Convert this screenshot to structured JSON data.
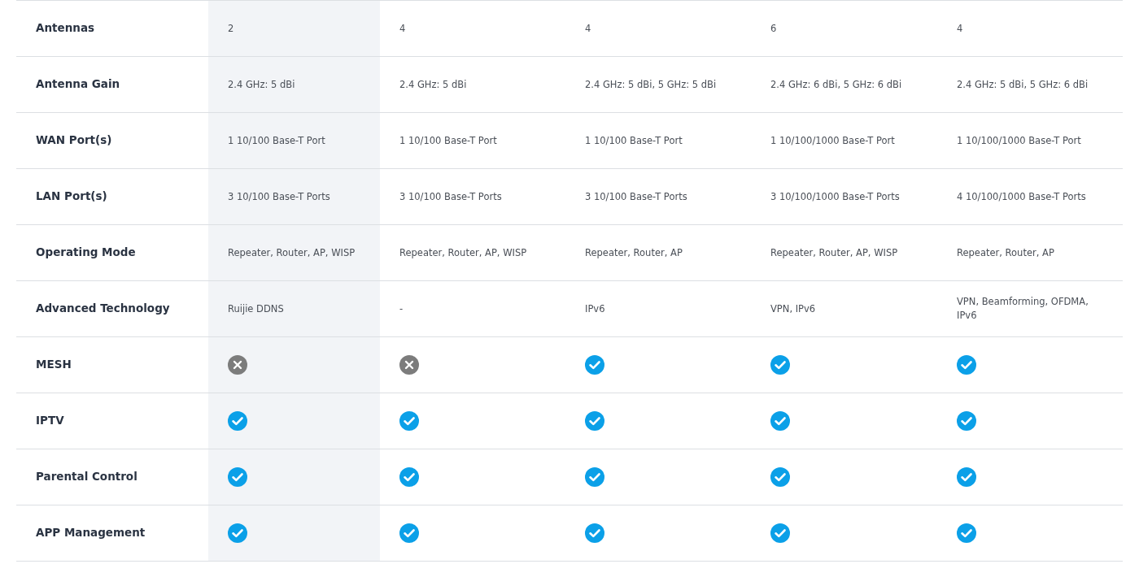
{
  "columns": [
    {
      "highlighted": true
    },
    {
      "highlighted": false
    },
    {
      "highlighted": false
    },
    {
      "highlighted": false
    },
    {
      "highlighted": false
    }
  ],
  "rows": [
    {
      "label": "Antennas",
      "cells": [
        {
          "kind": "text",
          "text": "2"
        },
        {
          "kind": "text",
          "text": "4"
        },
        {
          "kind": "text",
          "text": "4"
        },
        {
          "kind": "text",
          "text": "6"
        },
        {
          "kind": "text",
          "text": "4"
        }
      ]
    },
    {
      "label": "Antenna Gain",
      "cells": [
        {
          "kind": "text",
          "text": "2.4 GHz: 5 dBi"
        },
        {
          "kind": "text",
          "text": "2.4 GHz: 5 dBi"
        },
        {
          "kind": "text",
          "text": "2.4 GHz: 5 dBi, 5 GHz: 5 dBi"
        },
        {
          "kind": "text",
          "text": "2.4 GHz: 6 dBi, 5 GHz: 6 dBi"
        },
        {
          "kind": "text",
          "text": "2.4 GHz: 5 dBi, 5 GHz: 6 dBi"
        }
      ]
    },
    {
      "label": "WAN Port(s)",
      "cells": [
        {
          "kind": "text",
          "text": "1 10/100 Base-T Port"
        },
        {
          "kind": "text",
          "text": "1 10/100 Base-T Port"
        },
        {
          "kind": "text",
          "text": "1 10/100 Base-T Port"
        },
        {
          "kind": "text",
          "text": "1 10/100/1000 Base-T Port"
        },
        {
          "kind": "text",
          "text": "1 10/100/1000 Base-T Port"
        }
      ]
    },
    {
      "label": "LAN Port(s)",
      "cells": [
        {
          "kind": "text",
          "text": "3 10/100 Base-T Ports"
        },
        {
          "kind": "text",
          "text": "3 10/100 Base-T Ports"
        },
        {
          "kind": "text",
          "text": "3 10/100 Base-T Ports"
        },
        {
          "kind": "text",
          "text": "3 10/100/1000 Base-T Ports"
        },
        {
          "kind": "text",
          "text": "4 10/100/1000 Base-T Ports"
        }
      ]
    },
    {
      "label": "Operating Mode",
      "cells": [
        {
          "kind": "text",
          "text": "Repeater, Router, AP, WISP"
        },
        {
          "kind": "text",
          "text": "Repeater, Router, AP, WISP"
        },
        {
          "kind": "text",
          "text": "Repeater, Router, AP"
        },
        {
          "kind": "text",
          "text": "Repeater, Router, AP, WISP"
        },
        {
          "kind": "text",
          "text": "Repeater, Router, AP"
        }
      ]
    },
    {
      "label": "Advanced Technology",
      "cells": [
        {
          "kind": "text",
          "text": "Ruijie DDNS"
        },
        {
          "kind": "text",
          "text": "-"
        },
        {
          "kind": "text",
          "text": "IPv6"
        },
        {
          "kind": "text",
          "text": "VPN, IPv6"
        },
        {
          "kind": "text",
          "text": "VPN, Beamforming, OFDMA, IPv6"
        }
      ]
    },
    {
      "label": "MESH",
      "cells": [
        {
          "kind": "support",
          "supported": false
        },
        {
          "kind": "support",
          "supported": false
        },
        {
          "kind": "support",
          "supported": true
        },
        {
          "kind": "support",
          "supported": true
        },
        {
          "kind": "support",
          "supported": true
        }
      ]
    },
    {
      "label": "IPTV",
      "cells": [
        {
          "kind": "support",
          "supported": true
        },
        {
          "kind": "support",
          "supported": true
        },
        {
          "kind": "support",
          "supported": true
        },
        {
          "kind": "support",
          "supported": true
        },
        {
          "kind": "support",
          "supported": true
        }
      ]
    },
    {
      "label": "Parental Control",
      "cells": [
        {
          "kind": "support",
          "supported": true
        },
        {
          "kind": "support",
          "supported": true
        },
        {
          "kind": "support",
          "supported": true
        },
        {
          "kind": "support",
          "supported": true
        },
        {
          "kind": "support",
          "supported": true
        }
      ]
    },
    {
      "label": "APP Management",
      "cells": [
        {
          "kind": "support",
          "supported": true
        },
        {
          "kind": "support",
          "supported": true
        },
        {
          "kind": "support",
          "supported": true
        },
        {
          "kind": "support",
          "supported": true
        },
        {
          "kind": "support",
          "supported": true
        }
      ]
    }
  ]
}
